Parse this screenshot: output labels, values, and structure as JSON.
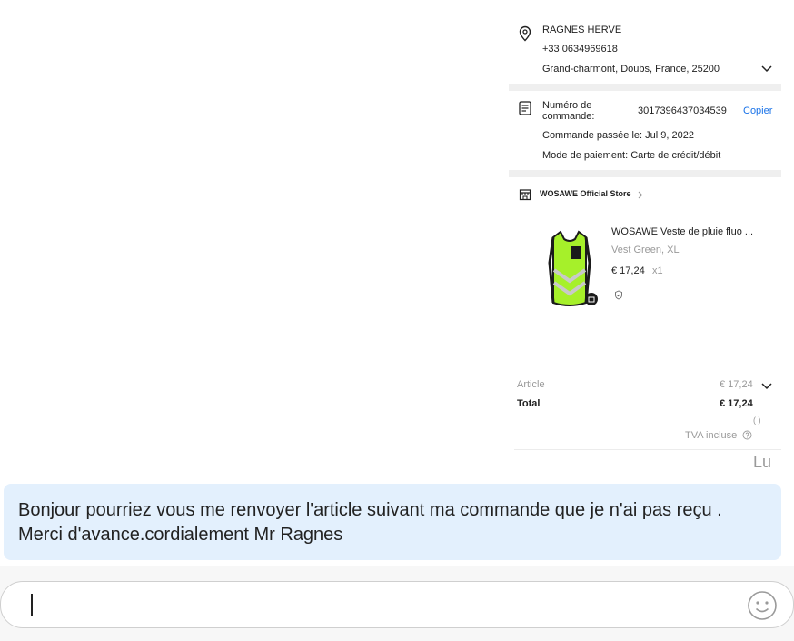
{
  "address": {
    "name": "RAGNES HERVE",
    "phone": "+33 0634969618",
    "location": "Grand-charmont, Doubs, France, 25200"
  },
  "order": {
    "number_label_line1": "Numéro de",
    "number_label_line2": "commande:",
    "number": "3017396437034539",
    "copy_label": "Copier",
    "placed": "Commande passée le: Jul 9, 2022",
    "payment": "Mode de paiement: Carte de crédit/débit"
  },
  "store": {
    "name": "WOSAWE Official Store"
  },
  "product": {
    "title": "WOSAWE Veste de pluie fluo ...",
    "variant": "Vest Green, XL",
    "price": "€ 17,24",
    "qty": "x1",
    "image_colors": {
      "vest": "#a6f02a",
      "trim": "#1b1b1b",
      "reflective": "#c9c9c9"
    }
  },
  "summary": {
    "article_label": "Article",
    "article_value": "€ 17,24",
    "total_label": "Total",
    "total_value": "€ 17,24",
    "paren": "( )",
    "tva": "TVA incluse"
  },
  "status": {
    "read": "Lu"
  },
  "message": {
    "line1": "Bonjour pourriez vous me renvoyer l'article suivant ma commande que je n'ai pas reçu .",
    "line2": "Merci d'avance.cordialement Mr Ragnes"
  },
  "composer": {
    "value": ""
  },
  "colors": {
    "bubble": "#e3f0fd",
    "link": "#1a73e8",
    "separator": "#efefef"
  }
}
